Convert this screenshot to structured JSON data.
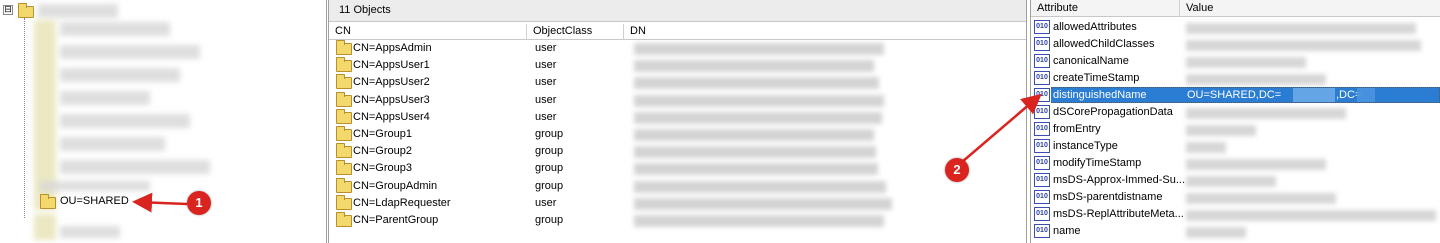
{
  "tree": {
    "expander_symbol": "⊟",
    "selected_node_label": "OU=SHARED"
  },
  "objects": {
    "title": "11 Objects",
    "columns": [
      "CN",
      "ObjectClass",
      "DN"
    ],
    "rows": [
      {
        "cn": "CN=AppsAdmin",
        "class": "user"
      },
      {
        "cn": "CN=AppsUser1",
        "class": "user"
      },
      {
        "cn": "CN=AppsUser2",
        "class": "user"
      },
      {
        "cn": "CN=AppsUser3",
        "class": "user"
      },
      {
        "cn": "CN=AppsUser4",
        "class": "user"
      },
      {
        "cn": "CN=Group1",
        "class": "group"
      },
      {
        "cn": "CN=Group2",
        "class": "group"
      },
      {
        "cn": "CN=Group3",
        "class": "group"
      },
      {
        "cn": "CN=GroupAdmin",
        "class": "group"
      },
      {
        "cn": "CN=LdapRequester",
        "class": "user"
      },
      {
        "cn": "CN=ParentGroup",
        "class": "group"
      }
    ]
  },
  "attributes": {
    "columns": [
      "Attribute",
      "Value"
    ],
    "icon_text": "010",
    "rows": [
      {
        "name": "allowedAttributes"
      },
      {
        "name": "allowedChildClasses"
      },
      {
        "name": "canonicalName"
      },
      {
        "name": "createTimeStamp"
      },
      {
        "name": "distinguishedName",
        "value": "OU=SHARED,DC=",
        "value2": ",DC=",
        "selected": true
      },
      {
        "name": "dSCorePropagationData"
      },
      {
        "name": "fromEntry"
      },
      {
        "name": "instanceType"
      },
      {
        "name": "modifyTimeStamp"
      },
      {
        "name": "msDS-Approx-Immed-Su..."
      },
      {
        "name": "msDS-parentdistname"
      },
      {
        "name": "msDS-ReplAttributeMeta..."
      },
      {
        "name": "name"
      }
    ]
  },
  "callouts": {
    "badge1": "1",
    "badge2": "2",
    "color": "#d9241f"
  },
  "colors": {
    "selection": "#2b7cd3",
    "folder": "#f3d96b"
  }
}
